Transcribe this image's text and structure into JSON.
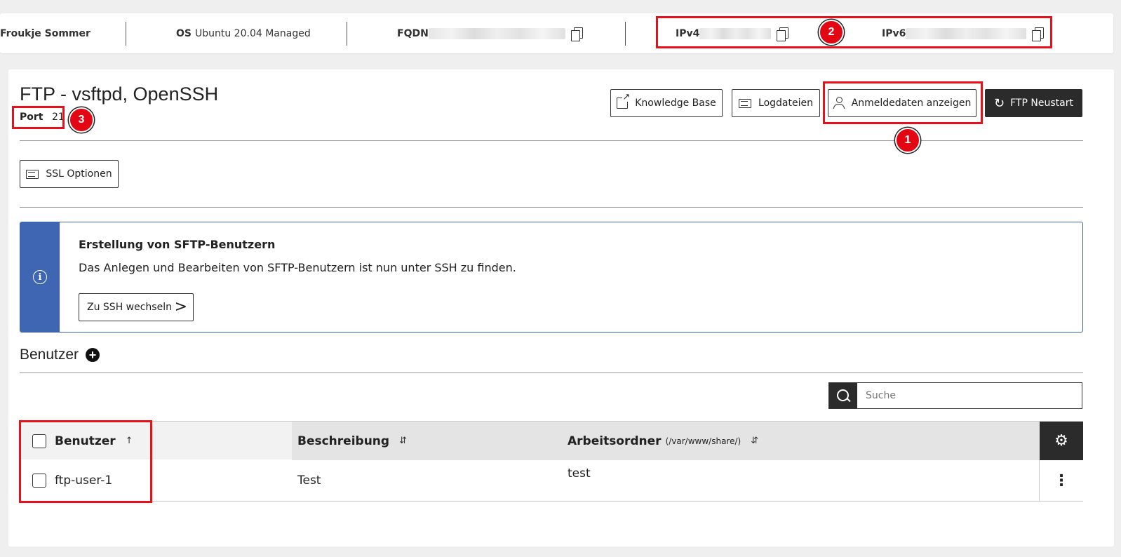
{
  "topbar": {
    "user": "Froukje Sommer",
    "os_label": "OS",
    "os_value": "Ubuntu 20.04 Managed",
    "fqdn_label": "FQDN",
    "ipv4_label": "IPv4",
    "ipv6_label": "IPv6"
  },
  "service": {
    "title": "FTP - vsftpd, OpenSSH",
    "port_label": "Port",
    "port_value": "21"
  },
  "toolbar": {
    "knowledge_base": "Knowledge Base",
    "logfiles": "Logdateien",
    "show_credentials": "Anmeldedaten anzeigen",
    "restart": "FTP Neustart",
    "ssl_options": "SSL Optionen"
  },
  "info": {
    "title": "Erstellung von SFTP-Benutzern",
    "text": "Das Anlegen und Bearbeiten von SFTP-Benutzern ist nun unter SSH zu finden.",
    "button": "Zu SSH wechseln"
  },
  "users": {
    "section_title": "Benutzer",
    "search_placeholder": "Suche",
    "columns": {
      "user": "Benutzer",
      "description": "Beschreibung",
      "workdir": "Arbeitsordner",
      "workdir_hint": "(/var/www/share/)"
    },
    "rows": [
      {
        "user": "ftp-user-1",
        "description": "Test",
        "workdir": "test"
      }
    ]
  },
  "annotations": [
    "1",
    "2",
    "3"
  ],
  "colors": {
    "highlight": "#e8101a",
    "info_accent": "#3f66b2",
    "dark_button": "#2b2b2b"
  }
}
